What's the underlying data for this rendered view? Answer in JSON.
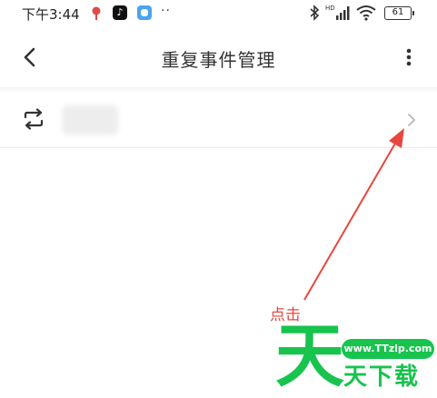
{
  "status_bar": {
    "time": "下午3:44",
    "hd_label": "HD",
    "battery": "61"
  },
  "header": {
    "title": "重复事件管理"
  },
  "list": {
    "items": [
      {
        "icon": "repeat-icon",
        "label_blurred": true
      }
    ]
  },
  "annotation": {
    "text": "点击",
    "color": "#e8463f"
  },
  "watermark": {
    "big_char": "天",
    "url": "www.TTzip.com",
    "sub": "天下载",
    "color": "#18c34e"
  }
}
